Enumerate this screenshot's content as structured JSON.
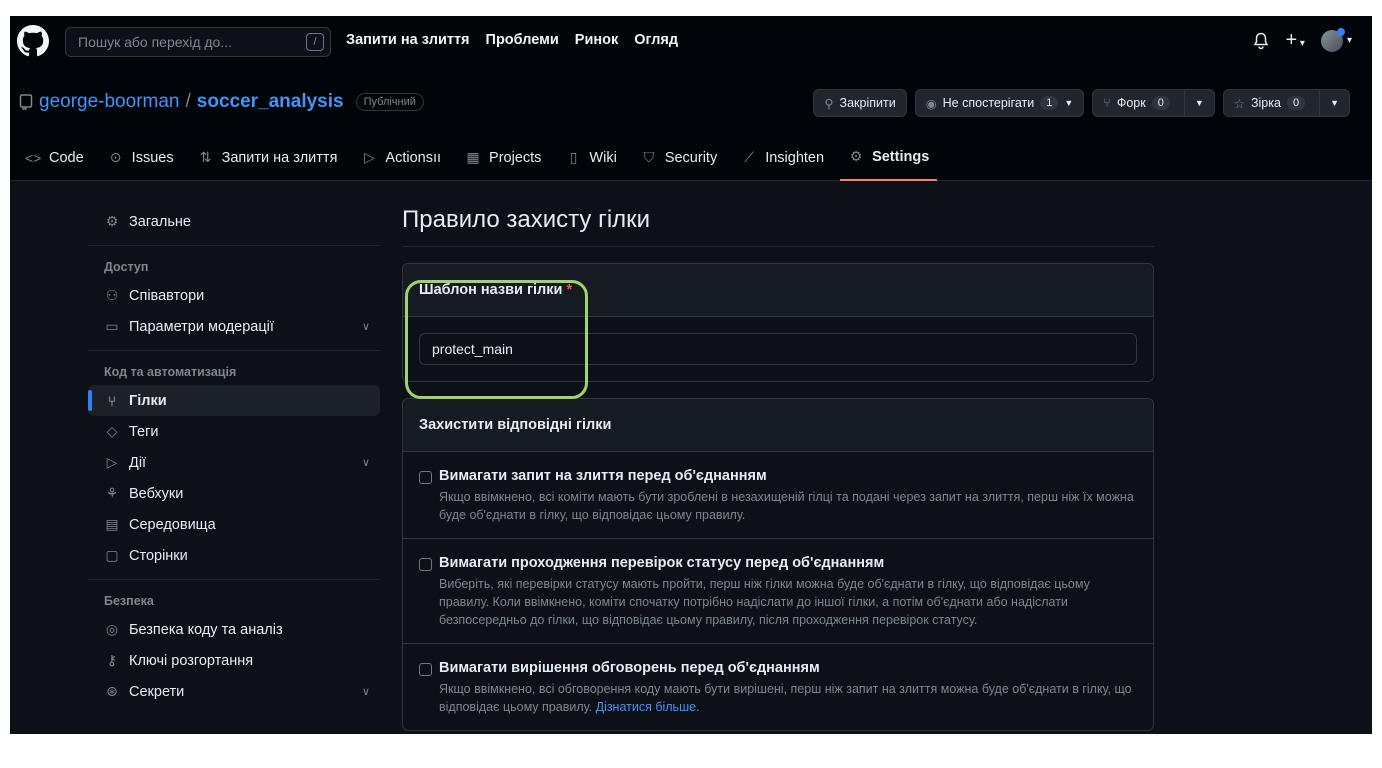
{
  "header": {
    "search_placeholder": "Пошук або перехід до...",
    "search_shortcut": "/",
    "nav": [
      "Запити на злиття",
      "Проблеми",
      "Ринок",
      "Огляд"
    ]
  },
  "repo": {
    "owner": "george-boorman",
    "separator": "/",
    "name": "soccer_analysis",
    "visibility": "Публічний",
    "pin_label": "Закріпити",
    "watch_label": "Не спостерігати",
    "watch_count": "1",
    "fork_label": "Форк",
    "fork_count": "0",
    "star_label": "Зірка",
    "star_count": "0"
  },
  "tabs": [
    {
      "label": "Code",
      "icon": "code-icon"
    },
    {
      "label": "Issues",
      "icon": "issue-icon"
    },
    {
      "label": "Запити на злиття",
      "icon": "pull-request-icon"
    },
    {
      "label": "Actionsıı",
      "icon": "play-icon"
    },
    {
      "label": "Projects",
      "icon": "table-icon"
    },
    {
      "label": "Wiki",
      "icon": "book-icon"
    },
    {
      "label": "Security",
      "icon": "shield-icon"
    },
    {
      "label": "Insighten",
      "icon": "graph-icon"
    },
    {
      "label": "Settings",
      "icon": "gear-icon",
      "active": true
    }
  ],
  "sidebar": {
    "general": "Загальне",
    "access_heading": "Доступ",
    "collaborators": "Співавтори",
    "moderation": "Параметри модерації",
    "code_heading": "Код та автоматизація",
    "branches": "Гілки",
    "tags": "Теги",
    "actions": "Дії",
    "webhooks": "Вебхуки",
    "environments": "Середовища",
    "pages": "Сторінки",
    "security_heading": "Безпека",
    "code_security": "Безпека коду та аналіз",
    "deploy_keys": "Ключі розгортання",
    "secrets": "Секрети"
  },
  "main": {
    "title": "Правило захисту гілки",
    "pattern_label": "Шаблон назви гілки",
    "required_mark": "*",
    "pattern_value": "protect_main",
    "protect_heading": "Захистити відповідні гілки",
    "rules": [
      {
        "title": "Вимагати запит на злиття перед об'єднанням",
        "desc": "Якщо ввімкнено, всі коміти мають бути зроблені в незахищеній гілці та подані через запит на злиття, перш ніж їх можна буде об'єднати в гілку, що відповідає цьому правилу."
      },
      {
        "title": "Вимагати проходження перевірок статусу перед об'єднанням",
        "desc": "Виберіть, які перевірки статусу мають пройти, перш ніж гілки можна буде об'єднати в гілку, що відповідає цьому правилу. Коли ввімкнено, коміти спочатку потрібно надіслати до іншої гілки, а потім об'єднати або надіслати безпосередньо до гілки, що відповідає цьому правилу, після проходження перевірок статусу."
      },
      {
        "title": "Вимагати вирішення обговорень перед об'єднанням",
        "desc": "Якщо ввімкнено, всі обговорення коду мають бути вирішені, перш ніж запит на злиття можна буде об'єднати в гілку, що відповідає цьому правилу.",
        "link": "Дізнатися більше"
      }
    ]
  },
  "colors": {
    "accent_link": "#4493f8",
    "active_tab_underline": "#f78166",
    "highlight_ring": "#9fd36b",
    "required": "#f85149"
  }
}
